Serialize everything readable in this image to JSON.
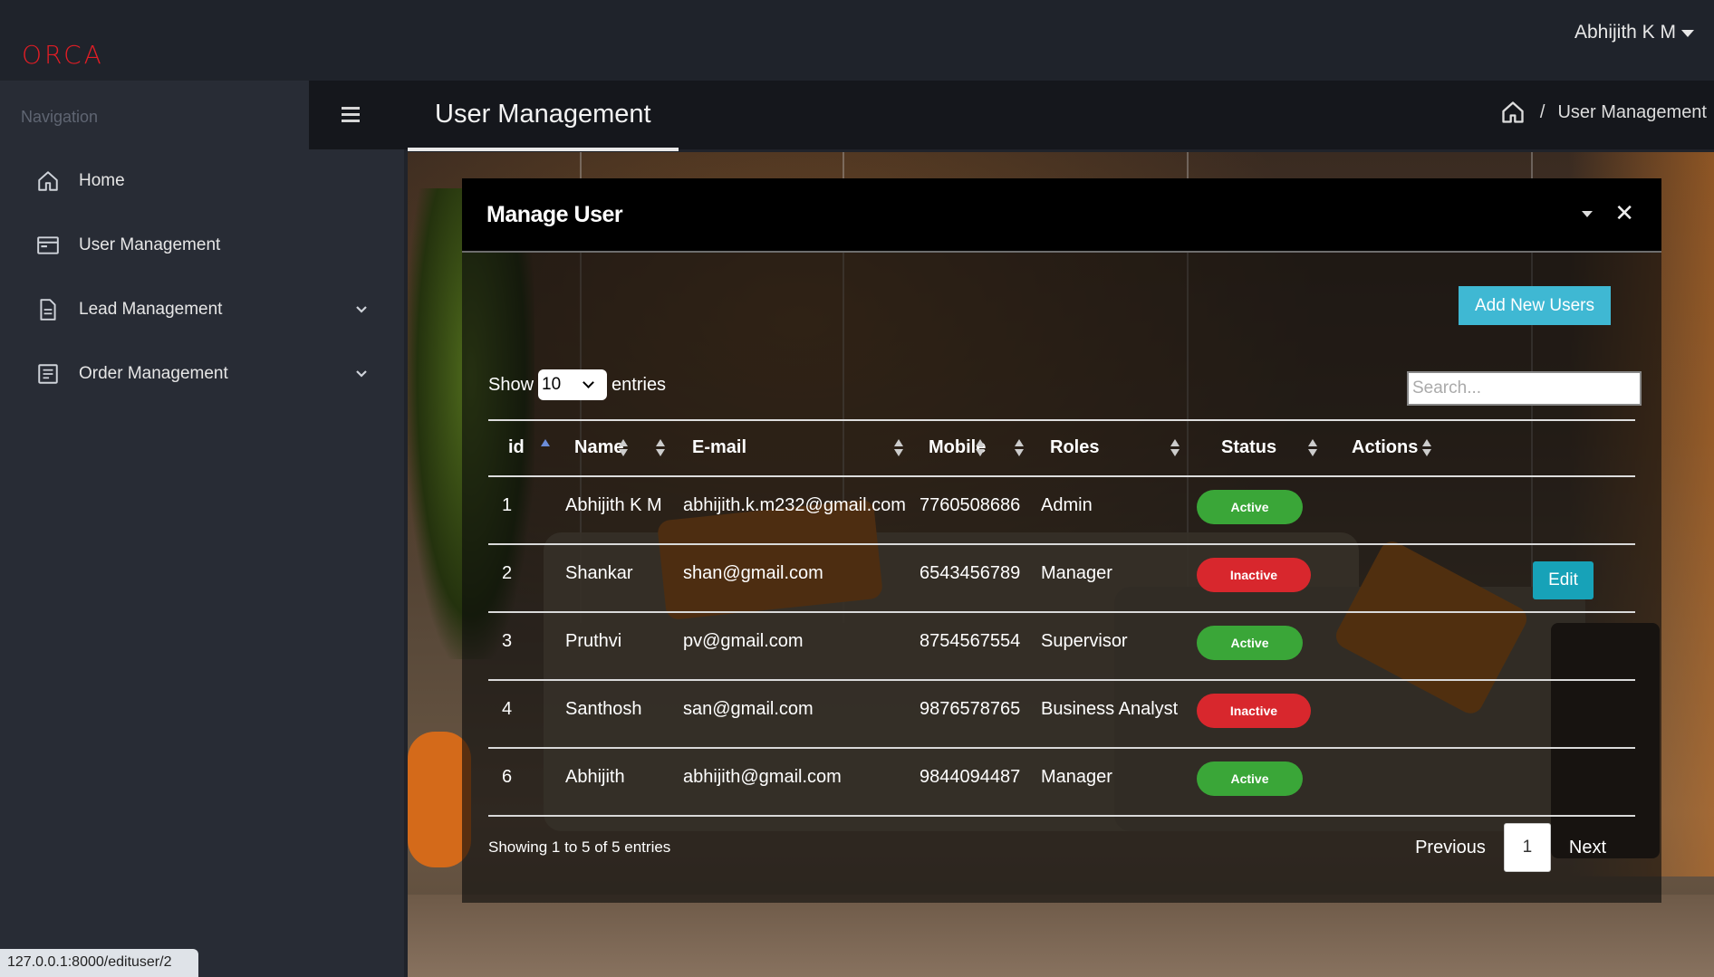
{
  "app": {
    "logo": "ORCA",
    "user_menu": "Abhijith K M"
  },
  "sidebar": {
    "heading": "Navigation",
    "items": [
      {
        "label": "Home",
        "icon": "home-icon"
      },
      {
        "label": "User Management",
        "icon": "window-icon"
      },
      {
        "label": "Lead Management",
        "icon": "document-icon",
        "expandable": true
      },
      {
        "label": "Order Management",
        "icon": "list-doc-icon",
        "expandable": true
      }
    ]
  },
  "header": {
    "title": "User Management",
    "breadcrumb": {
      "separator": "/",
      "current": "User Management"
    }
  },
  "card": {
    "title": "Manage User",
    "add_button": "Add New Users",
    "length": {
      "show": "Show",
      "value": "10",
      "entries": "entries"
    },
    "search_placeholder": "Search...",
    "columns": [
      "id",
      "Name",
      "E-mail",
      "Mobile",
      "Roles",
      "Status",
      "Actions"
    ],
    "rows": [
      {
        "id": "1",
        "name": "Abhijith K M",
        "email": "abhijith.k.m232@gmail.com",
        "mobile": "7760508686",
        "role": "Admin",
        "status": "Active",
        "action": ""
      },
      {
        "id": "2",
        "name": "Shankar",
        "email": "shan@gmail.com",
        "mobile": "6543456789",
        "role": "Manager",
        "status": "Inactive",
        "action": "Edit"
      },
      {
        "id": "3",
        "name": "Pruthvi",
        "email": "pv@gmail.com",
        "mobile": "8754567554",
        "role": "Supervisor",
        "status": "Active",
        "action": ""
      },
      {
        "id": "4",
        "name": "Santhosh",
        "email": "san@gmail.com",
        "mobile": "9876578765",
        "role": "Business Analyst",
        "status": "Inactive",
        "action": ""
      },
      {
        "id": "6",
        "name": "Abhijith",
        "email": "abhijith@gmail.com",
        "mobile": "9844094487",
        "role": "Manager",
        "status": "Active",
        "action": ""
      }
    ],
    "info": "Showing 1 to 5 of 5 entries",
    "pagination": {
      "previous": "Previous",
      "current": "1",
      "next": "Next"
    }
  },
  "status_bar_url": "127.0.0.1:8000/edituser/2",
  "colors": {
    "logo": "#e01d25",
    "active": "#3aa638",
    "inactive": "#d8272d",
    "primary_button": "#3fb8d3",
    "edit_button": "#17a2b8"
  }
}
